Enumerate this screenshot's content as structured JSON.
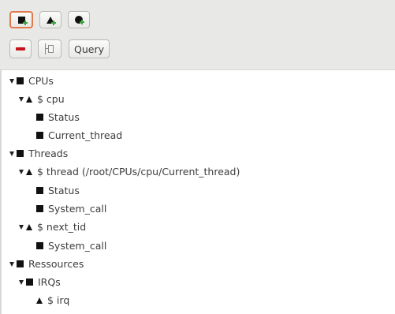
{
  "toolbar": {
    "add_node_tooltip": "Add node",
    "add_attribute_tooltip": "Add attribute",
    "add_constant_tooltip": "Add constant",
    "remove_tooltip": "Remove",
    "frame_tooltip": "Frame",
    "query_label": "Query"
  },
  "tree": {
    "cpus": "CPUs",
    "cpu_var": "$ cpu",
    "cpu_status": "Status",
    "cpu_current_thread": "Current_thread",
    "threads": "Threads",
    "thread_var": "$ thread (/root/CPUs/cpu/Current_thread)",
    "thread_status": "Status",
    "thread_system_call": "System_call",
    "next_tid_var": "$ next_tid",
    "next_tid_system_call": "System_call",
    "ressources": "Ressources",
    "irqs": "IRQs",
    "irq_var": "$ irq"
  }
}
